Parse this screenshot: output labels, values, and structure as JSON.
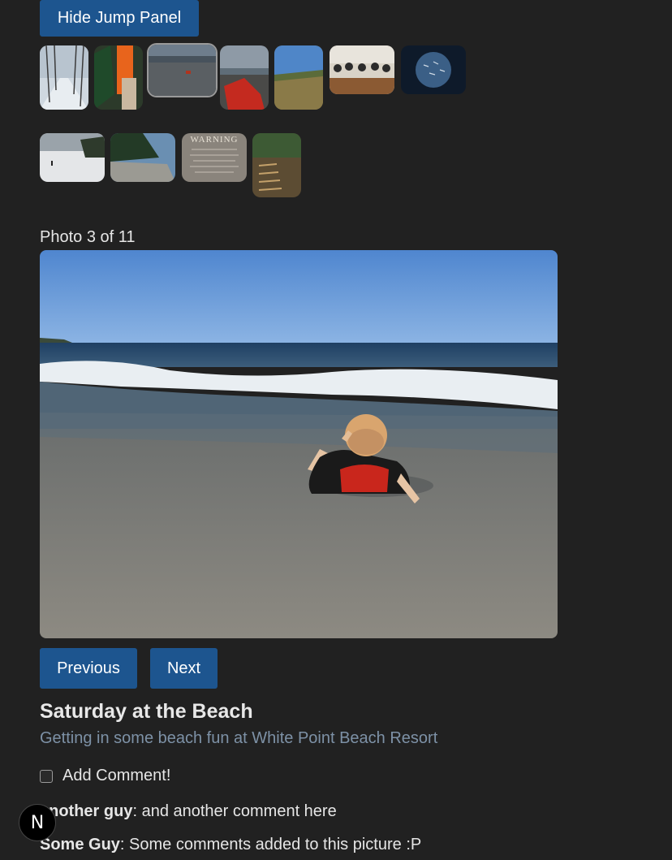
{
  "jump_panel": {
    "toggle_label": "Hide Jump Panel",
    "thumbnails": [
      {
        "name": "thumb-snowy-path",
        "selected": false
      },
      {
        "name": "thumb-orange-jacket-tree",
        "selected": false
      },
      {
        "name": "thumb-beach-kid",
        "selected": true
      },
      {
        "name": "thumb-red-chairs",
        "selected": false
      },
      {
        "name": "thumb-hill-view",
        "selected": false
      },
      {
        "name": "thumb-group-dinner",
        "selected": false
      },
      {
        "name": "thumb-fish-underwater",
        "selected": false
      },
      {
        "name": "thumb-snow-lake",
        "selected": false
      },
      {
        "name": "thumb-rocky-shore",
        "selected": false
      },
      {
        "name": "thumb-warning-sign",
        "selected": false
      },
      {
        "name": "thumb-forest-stairs",
        "selected": false
      }
    ],
    "warning_sign_text": "WARNING"
  },
  "viewer": {
    "counter": "Photo 3 of 11",
    "previous_label": "Previous",
    "next_label": "Next"
  },
  "photo": {
    "title": "Saturday at the Beach",
    "description": "Getting in some beach fun at White Point Beach Resort"
  },
  "comments": {
    "toggle_label": "Add Comment!",
    "items": [
      {
        "author": "another guy",
        "text": ": and another comment here"
      },
      {
        "author": "Some Guy",
        "text": ": Some comments added to this picture :P"
      }
    ]
  },
  "badge": {
    "letter": "N"
  },
  "colors": {
    "background": "#212121",
    "button": "#1d558f",
    "description": "#7d91a6"
  }
}
